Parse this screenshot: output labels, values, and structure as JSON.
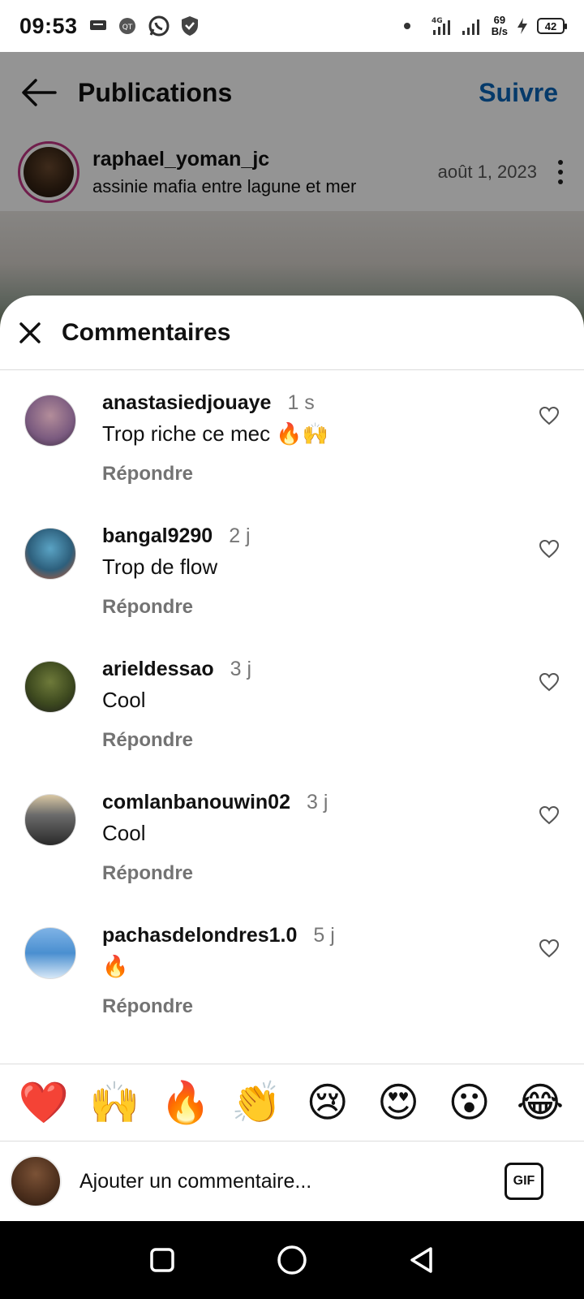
{
  "status_bar": {
    "time": "09:53",
    "net_speed_value": "69",
    "net_speed_unit": "B/s",
    "battery": "42",
    "network": "4G"
  },
  "post": {
    "header_title": "Publications",
    "follow_label": "Suivre",
    "author": "raphael_yoman_jc",
    "location": "assinie mafia entre lagune et mer",
    "date": "août 1, 2023"
  },
  "sheet": {
    "title": "Commentaires"
  },
  "comments": [
    {
      "user": "anastasiedjouaye",
      "time": "1 s",
      "text": "Trop riche ce mec 🔥🙌",
      "reply": "Répondre",
      "avatar_color": "#8a6a8f"
    },
    {
      "user": "bangal9290",
      "time": "2 j",
      "text": "Trop de flow",
      "reply": "Répondre",
      "avatar_color": "#3c6d8c"
    },
    {
      "user": "arieldessao",
      "time": "3 j",
      "text": "Cool",
      "reply": "Répondre",
      "avatar_color": "#4f5d2b"
    },
    {
      "user": "comlanbanouwin02",
      "time": "3 j",
      "text": "Cool",
      "reply": "Répondre",
      "avatar_color": "#5a5a5a"
    },
    {
      "user": "pachasdelondres1.0",
      "time": "5 j",
      "text": "🔥",
      "reply": "Répondre",
      "avatar_color": "#4a8fd0"
    }
  ],
  "emoji_bar": [
    "❤️",
    "🙌",
    "🔥",
    "👏",
    "😢",
    "😍",
    "😮",
    "😂"
  ],
  "input": {
    "placeholder": "Ajouter un commentaire...",
    "gif_label": "GIF"
  },
  "colors": {
    "accent": "#0a64b7",
    "story_ring": "#c13584",
    "secondary_text": "#737373"
  }
}
